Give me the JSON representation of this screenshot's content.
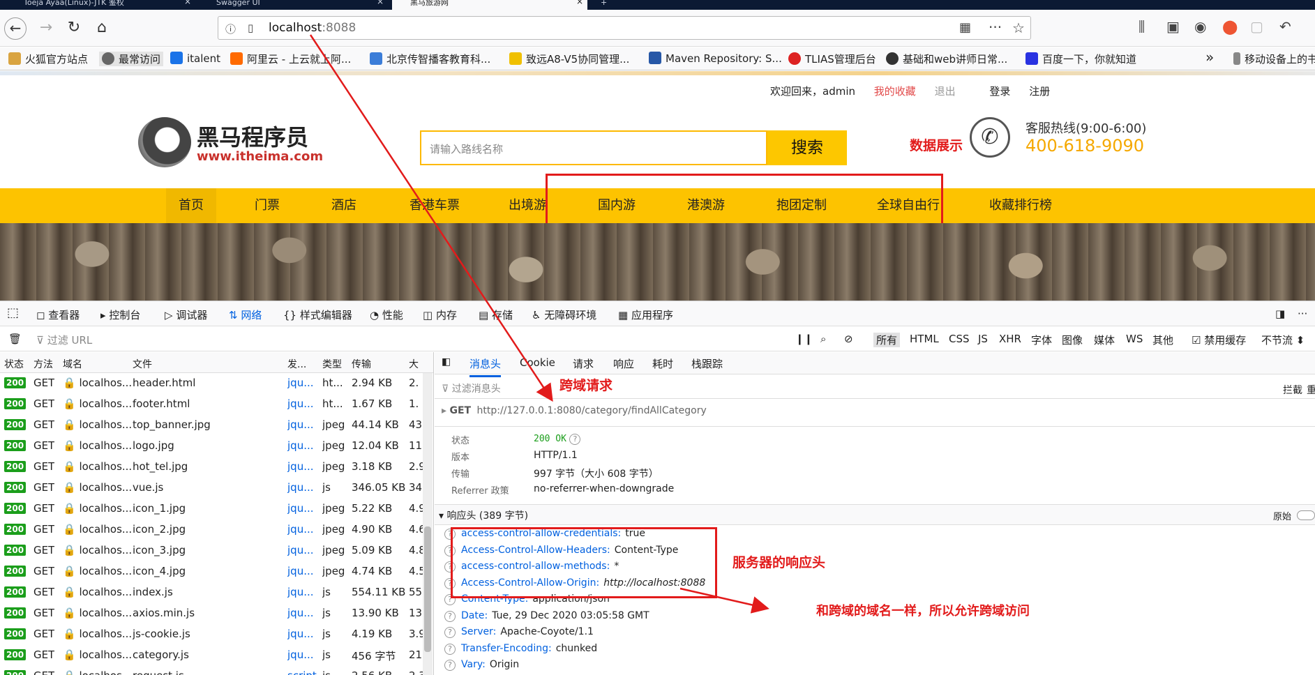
{
  "browser": {
    "tabs": [
      {
        "title": "Toeja Ayaa(Linux)-JTK 鉴权"
      },
      {
        "title": "Swagger UI"
      },
      {
        "title": "黑马旅游网"
      }
    ],
    "url_host": "localhost",
    "url_port": ":8088",
    "bookmarks": [
      "火狐官方站点",
      "最常访问",
      "italent",
      "阿里云 - 上云就上阿...",
      "北京传智播客教育科...",
      "致远A8-V5协同管理...",
      "Maven Repository: S...",
      "TLIAS管理后台",
      "基础和web讲师日常...",
      "百度一下，你就知道",
      "移动设备上的书签"
    ],
    "overflow": "»"
  },
  "site": {
    "welcome": "欢迎回来，admin",
    "my_fav": "我的收藏",
    "logout": "退出",
    "login": "登录",
    "register": "注册",
    "logo_text": "黑马程序员",
    "logo_url": "www.itheima.com",
    "search_placeholder": "请输入路线名称",
    "search_btn": "搜索",
    "hotline_label": "客服热线(9:00-6:00)",
    "hotline_num": "400-618-9090",
    "menu": [
      "首页",
      "门票",
      "酒店",
      "香港车票",
      "出境游",
      "国内游",
      "港澳游",
      "抱团定制",
      "全球自由行",
      "收藏排行榜"
    ]
  },
  "devtools": {
    "tools": [
      "查看器",
      "控制台",
      "调试器",
      "网络",
      "样式编辑器",
      "性能",
      "内存",
      "存储",
      "无障碍环境",
      "应用程序"
    ],
    "filter_placeholder": "过滤 URL",
    "type_filters": [
      "所有",
      "HTML",
      "CSS",
      "JS",
      "XHR",
      "字体",
      "图像",
      "媒体",
      "WS",
      "其他"
    ],
    "disable_cache": "禁用缓存",
    "throttle": "不节流 ⬍",
    "columns": [
      "状态",
      "方法",
      "域名",
      "文件",
      "发...",
      "类型",
      "传输",
      "大"
    ],
    "requests": [
      {
        "status": "200",
        "method": "GET",
        "domain": "localhos...",
        "file": "header.html",
        "cause": "jqu...",
        "type": "ht...",
        "transfer": "2.94 KB",
        "size": "2."
      },
      {
        "status": "200",
        "method": "GET",
        "domain": "localhos...",
        "file": "footer.html",
        "cause": "jqu...",
        "type": "ht...",
        "transfer": "1.67 KB",
        "size": "1."
      },
      {
        "status": "200",
        "method": "GET",
        "domain": "localhos...",
        "file": "top_banner.jpg",
        "cause": "jqu...",
        "type": "jpeg",
        "transfer": "44.14 KB",
        "size": "43"
      },
      {
        "status": "200",
        "method": "GET",
        "domain": "localhos...",
        "file": "logo.jpg",
        "cause": "jqu...",
        "type": "jpeg",
        "transfer": "12.04 KB",
        "size": "11"
      },
      {
        "status": "200",
        "method": "GET",
        "domain": "localhos...",
        "file": "hot_tel.jpg",
        "cause": "jqu...",
        "type": "jpeg",
        "transfer": "3.18 KB",
        "size": "2.9"
      },
      {
        "status": "200",
        "method": "GET",
        "domain": "localhos...",
        "file": "vue.js",
        "cause": "jqu...",
        "type": "js",
        "transfer": "346.05 KB",
        "size": "34"
      },
      {
        "status": "200",
        "method": "GET",
        "domain": "localhos...",
        "file": "icon_1.jpg",
        "cause": "jqu...",
        "type": "jpeg",
        "transfer": "5.22 KB",
        "size": "4.9"
      },
      {
        "status": "200",
        "method": "GET",
        "domain": "localhos...",
        "file": "icon_2.jpg",
        "cause": "jqu...",
        "type": "jpeg",
        "transfer": "4.90 KB",
        "size": "4.6"
      },
      {
        "status": "200",
        "method": "GET",
        "domain": "localhos...",
        "file": "icon_3.jpg",
        "cause": "jqu...",
        "type": "jpeg",
        "transfer": "5.09 KB",
        "size": "4.8"
      },
      {
        "status": "200",
        "method": "GET",
        "domain": "localhos...",
        "file": "icon_4.jpg",
        "cause": "jqu...",
        "type": "jpeg",
        "transfer": "4.74 KB",
        "size": "4.5"
      },
      {
        "status": "200",
        "method": "GET",
        "domain": "localhos...",
        "file": "index.js",
        "cause": "jqu...",
        "type": "js",
        "transfer": "554.11 KB",
        "size": "55"
      },
      {
        "status": "200",
        "method": "GET",
        "domain": "localhos...",
        "file": "axios.min.js",
        "cause": "jqu...",
        "type": "js",
        "transfer": "13.90 KB",
        "size": "13"
      },
      {
        "status": "200",
        "method": "GET",
        "domain": "localhos...",
        "file": "js-cookie.js",
        "cause": "jqu...",
        "type": "js",
        "transfer": "4.19 KB",
        "size": "3.9"
      },
      {
        "status": "200",
        "method": "GET",
        "domain": "localhos...",
        "file": "category.js",
        "cause": "jqu...",
        "type": "js",
        "transfer": "456 字节",
        "size": "21"
      },
      {
        "status": "200",
        "method": "GET",
        "domain": "localhos...",
        "file": "request.js",
        "cause": "script",
        "type": "js",
        "transfer": "2.56 KB",
        "size": "2.3"
      }
    ],
    "detail_tabs": [
      "消息头",
      "Cookie",
      "请求",
      "响应",
      "耗时",
      "栈跟踪"
    ],
    "filter_headers": "过滤消息头",
    "block": "拦截",
    "resend": "重",
    "request_method": "GET",
    "request_url": "http://127.0.0.1:8080/category/findAllCategory",
    "summary": [
      {
        "k": "状态",
        "v": "200 OK"
      },
      {
        "k": "版本",
        "v": "HTTP/1.1"
      },
      {
        "k": "传输",
        "v": "997 字节（大小 608 字节）"
      },
      {
        "k": "Referrer 政策",
        "v": "no-referrer-when-downgrade"
      }
    ],
    "resp_headers_title": "响应头 (389 字节)",
    "raw": "原始",
    "resp_headers": [
      {
        "k": "access-control-allow-credentials:",
        "v": "true"
      },
      {
        "k": "Access-Control-Allow-Headers:",
        "v": "Content-Type"
      },
      {
        "k": "access-control-allow-methods:",
        "v": "*"
      },
      {
        "k": "Access-Control-Allow-Origin:",
        "v": "http://localhost:8088"
      },
      {
        "k": "Content-Type:",
        "v": "application/json"
      },
      {
        "k": "Date:",
        "v": "Tue, 29 Dec 2020 03:05:58 GMT"
      },
      {
        "k": "Server:",
        "v": "Apache-Coyote/1.1"
      },
      {
        "k": "Transfer-Encoding:",
        "v": "chunked"
      },
      {
        "k": "Vary:",
        "v": "Origin"
      }
    ]
  },
  "annotations": {
    "data_display": "数据展示",
    "cross_request": "跨域请求",
    "server_headers": "服务器的响应头",
    "explain": "和跨域的域名一样，所以允许跨域访问"
  },
  "colors": {
    "accent": "#0060df",
    "brand_yellow": "#fdc300",
    "annotation_red": "#e21b1b",
    "status_green": "#1b9e1b"
  }
}
